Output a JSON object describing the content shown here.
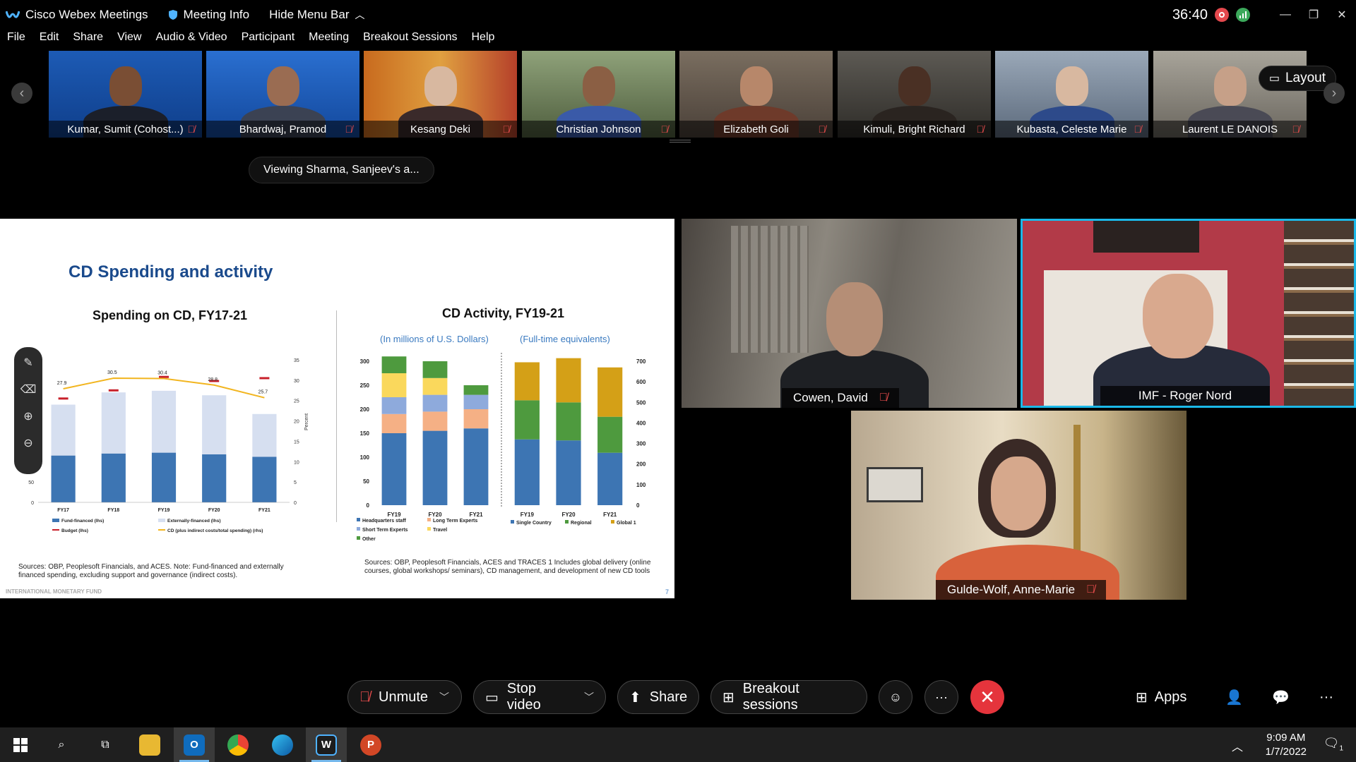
{
  "titlebar": {
    "app_title": "Cisco Webex Meetings",
    "meeting_info": "Meeting Info",
    "hide_menu": "Hide Menu Bar",
    "timer": "36:40"
  },
  "menu": [
    "File",
    "Edit",
    "Share",
    "View",
    "Audio & Video",
    "Participant",
    "Meeting",
    "Breakout Sessions",
    "Help"
  ],
  "participants_strip": [
    {
      "name": "Kumar, Sumit  (Cohost...)",
      "muted": true
    },
    {
      "name": "Bhardwaj, Pramod",
      "muted": true
    },
    {
      "name": "Kesang Deki",
      "muted": true
    },
    {
      "name": "Christian Johnson",
      "muted": true
    },
    {
      "name": "Elizabeth Goli",
      "muted": true
    },
    {
      "name": "Kimuli, Bright Richard",
      "muted": true
    },
    {
      "name": "Kubasta, Celeste Marie",
      "muted": true
    },
    {
      "name": "Laurent LE DANOIS",
      "muted": true
    }
  ],
  "layout_button": "Layout",
  "viewing_label": "Viewing Sharma, Sanjeev's a...",
  "slide": {
    "title": "CD Spending and activity",
    "left_chart_title": "Spending on CD, FY17-21",
    "right_chart_title": "CD Activity, FY19-21",
    "right_sub_left": "(In millions of U.S. Dollars)",
    "right_sub_right": "(Full-time equivalents)",
    "source_left": "Sources: OBP, Peoplesoft Financials, and ACES. Note: Fund-financed and externally financed spending, excluding support and governance (indirect costs).",
    "source_right": "Sources: OBP, Peoplesoft Financials, ACES and TRACES 1 Includes global delivery (online courses, global workshops/ seminars), CD management, and development of new CD tools",
    "footer": "INTERNATIONAL MONETARY FUND",
    "page": "7"
  },
  "chart_data": [
    {
      "type": "bar",
      "title": "Spending on CD, FY17-21",
      "categories": [
        "FY17",
        "FY18",
        "FY19",
        "FY20",
        "FY21"
      ],
      "series": [
        {
          "name": "Fund-financed (lhs)",
          "values": [
            115,
            120,
            122,
            118,
            112
          ]
        },
        {
          "name": "Externally-financed (lhs)",
          "values": [
            125,
            150,
            152,
            145,
            105
          ]
        },
        {
          "name": "Budget (lhs)",
          "values": [
            255,
            275,
            308,
            298,
            305
          ]
        },
        {
          "name": "CD (plus indirect costs/total spending) (rhs)",
          "values": [
            27.9,
            30.5,
            30.4,
            28.8,
            25.7
          ]
        }
      ],
      "data_labels": [
        "27.9",
        "30.5",
        "30.4",
        "28.8",
        "25.7"
      ],
      "ylim": [
        0,
        350
      ],
      "ylim_right": [
        0,
        35
      ],
      "ylabel_right": "Percent",
      "y_ticks": [
        "0",
        "50",
        "100",
        "150",
        "200",
        "250",
        "300",
        "350"
      ],
      "y_ticks_right": [
        "0",
        "5",
        "10",
        "15",
        "20",
        "25",
        "30",
        "35"
      ]
    },
    {
      "type": "bar",
      "subtitle": "(In millions of U.S. Dollars)",
      "categories": [
        "FY19",
        "FY20",
        "FY21"
      ],
      "series": [
        {
          "name": "Headquarters staff",
          "values": [
            150,
            155,
            160
          ]
        },
        {
          "name": "Long Term Experts",
          "values": [
            40,
            40,
            40
          ]
        },
        {
          "name": "Short Term Experts",
          "values": [
            35,
            35,
            30
          ]
        },
        {
          "name": "Travel",
          "values": [
            50,
            35,
            0
          ]
        },
        {
          "name": "Other",
          "values": [
            35,
            35,
            20
          ]
        }
      ],
      "ylim": [
        0,
        300
      ],
      "y_ticks": [
        "0",
        "50",
        "100",
        "150",
        "200",
        "250",
        "300"
      ]
    },
    {
      "type": "bar",
      "subtitle": "(Full-time equivalents)",
      "categories": [
        "FY19",
        "FY20",
        "FY21"
      ],
      "series": [
        {
          "name": "Single Country",
          "values": [
            320,
            315,
            255
          ]
        },
        {
          "name": "Regional",
          "values": [
            190,
            185,
            175
          ]
        },
        {
          "name": "Global 1",
          "values": [
            185,
            215,
            240
          ]
        }
      ],
      "ylim": [
        0,
        700
      ],
      "y_ticks": [
        "0",
        "100",
        "200",
        "300",
        "400",
        "500",
        "600",
        "700"
      ]
    }
  ],
  "tiles": [
    {
      "name": "Cowen, David",
      "muted": true
    },
    {
      "name": "IMF - Roger Nord",
      "muted": false
    },
    {
      "name": "Gulde-Wolf, Anne-Marie",
      "muted": true
    }
  ],
  "controls": {
    "unmute": "Unmute",
    "stop_video": "Stop video",
    "share": "Share",
    "breakout": "Breakout sessions",
    "apps": "Apps"
  },
  "taskbar": {
    "time": "9:09 AM",
    "date": "1/7/2022",
    "notification_count": "1"
  },
  "colors": {
    "accent": "#1bb8e8",
    "end_call": "#e5343c",
    "muted_mic": "#e34b4b",
    "slide_title": "#1a4a8c"
  }
}
